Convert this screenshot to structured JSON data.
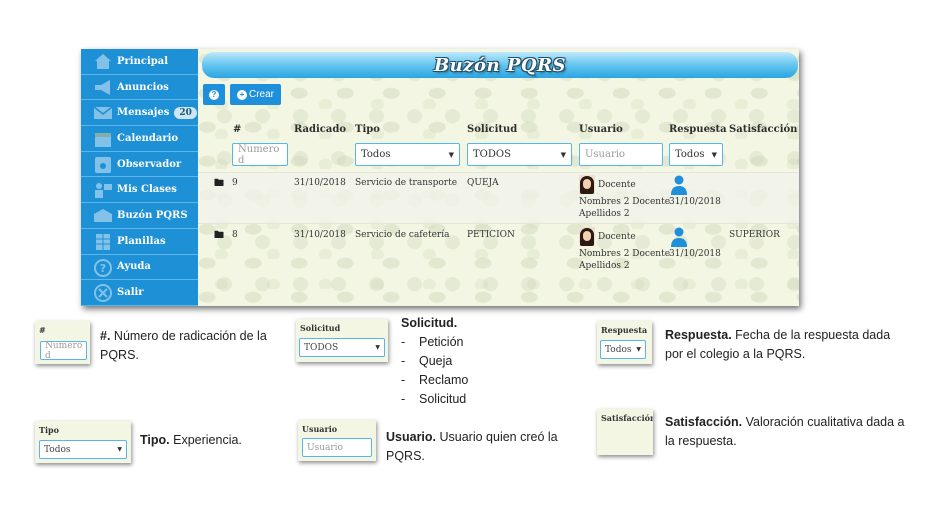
{
  "sidebar": {
    "items": [
      {
        "label": "Principal",
        "icon": "home-icon"
      },
      {
        "label": "Anuncios",
        "icon": "megaphone-icon"
      },
      {
        "label": "Mensajes",
        "icon": "envelope-icon",
        "badge": "20"
      },
      {
        "label": "Calendario",
        "icon": "calendar-icon"
      },
      {
        "label": "Observador",
        "icon": "observer-icon"
      },
      {
        "label": "Mis Clases",
        "icon": "classes-icon"
      },
      {
        "label": "Buzón PQRS",
        "icon": "mailbox-icon"
      },
      {
        "label": "Planillas",
        "icon": "spreadsheet-icon"
      },
      {
        "label": "Ayuda",
        "icon": "help-icon"
      },
      {
        "label": "Salir",
        "icon": "exit-icon"
      }
    ]
  },
  "header": {
    "title": "Buzón PQRS"
  },
  "toolbar": {
    "help_label": "?",
    "create_label": "Crear"
  },
  "table": {
    "columns": [
      "#",
      "Radicado",
      "Tipo",
      "Solicitud",
      "Usuario",
      "Respuesta",
      "Satisfacción"
    ],
    "filters": {
      "numero_placeholder": "Numero d",
      "tipo_value": "Todos",
      "solicitud_value": "TODOS",
      "usuario_placeholder": "Usuario",
      "respuesta_value": "Todos"
    },
    "rows": [
      {
        "num": "9",
        "radicado": "31/10/2018",
        "tipo": "Servicio de transporte",
        "solicitud": "QUEJA",
        "usuario_role": "Docente",
        "usuario_line1": "Nombres 2 Docente",
        "usuario_line2": "Apellidos 2",
        "respuesta": "31/10/2018",
        "satisfaccion": ""
      },
      {
        "num": "8",
        "radicado": "31/10/2018",
        "tipo": "Servicio de cafetería",
        "solicitud": "PETICION",
        "usuario_role": "Docente",
        "usuario_line1": "Nombres 2 Docente",
        "usuario_line2": "Apellidos 2",
        "respuesta": "31/10/2018",
        "satisfaccion": "SUPERIOR"
      }
    ]
  },
  "annotations": {
    "numero": {
      "thumb_label": "#",
      "thumb_value": "Numero d",
      "term": "#.",
      "text": " Número de radicación de la PQRS."
    },
    "tipo": {
      "thumb_label": "Tipo",
      "thumb_value": "Todos",
      "term": "Tipo.",
      "text": " Experiencia."
    },
    "solicitud": {
      "thumb_label": "Solicitud",
      "thumb_value": "TODOS",
      "term": "Solicitud.",
      "items": [
        "Petición",
        "Queja",
        "Reclamo",
        "Solicitud"
      ]
    },
    "usuario": {
      "thumb_label": "Usuario",
      "thumb_value": "Usuario",
      "term": "Usuario.",
      "text": " Usuario quien creó la PQRS."
    },
    "respuesta": {
      "thumb_label": "Respuesta",
      "thumb_value": "Todos",
      "term": "Respuesta.",
      "text": " Fecha de la respuesta dada por el colegio a la PQRS."
    },
    "satisfaccion": {
      "thumb_label": "Satisfacción",
      "term": "Satisfacción.",
      "text": " Valoración cualitativa dada a la respuesta."
    }
  },
  "colors": {
    "sidebar": "#1e90d6",
    "accent": "#1e8fdb",
    "title_gradient_end": "#2aa5e2"
  }
}
